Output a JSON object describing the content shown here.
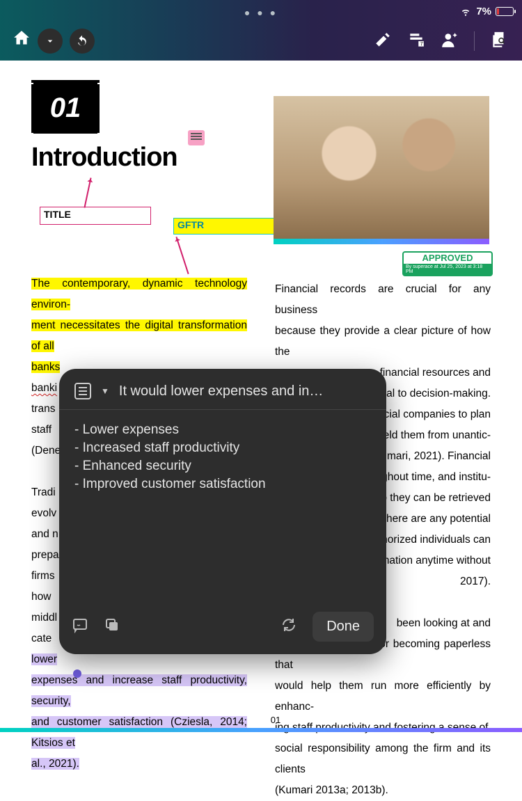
{
  "status": {
    "battery": "7%"
  },
  "chapter": {
    "num": "01",
    "title": "Introduction"
  },
  "annot": {
    "title_box": "TITLE",
    "gftr_box": "GFTR",
    "approved": "APPROVED",
    "approved_sub": "By superace at Jul 25, 2023 at 3:18 PM"
  },
  "col1": {
    "hl1": "The contemporary, dynamic technology environ-",
    "hl2": "ment necessitates the digital transformation of all",
    "hl3": "banks",
    "r1": "banki",
    "r2": "trans",
    "r3": "staff",
    "r4": "(Dene",
    "p2a": "Tradi",
    "p2b": "evolv",
    "p2c": "and n",
    "p2d": "prepa",
    "p2e": "firms",
    "p2f": "how",
    "p2g": "middl",
    "p2h_pre": "cate with them (Cziesla, 2014). ",
    "p2h_hl": "It would lower",
    "p2i": "expenses and increase staff productivity, security,",
    "p2j": "and customer satisfaction (Cziesla, 2014; Kitsios et",
    "p2k": "al., 2021)."
  },
  "col2": {
    "l1": "Financial records are crucial for any business",
    "l2": "because they provide a clear picture of how the",
    "l3r": "financial resources and",
    "l4r": "ntial to decision-making.",
    "l5r": "ancial companies to plan",
    "l6r": "shield them from unantic-",
    "l7r": "(Kumari, 2021). Financial",
    "l8r": "oughout time, and institu-",
    "l9r": "so they can be retrieved",
    "l10r": "if there are any potential",
    "l11r": "thorized individuals can",
    "l12r": "mation anytime without",
    "l13r": " 2017).",
    "l14r": "been looking at and",
    "l15": "developing methods for becoming paperless that",
    "l16": "would help them run more efficiently by enhanc-",
    "l17": "ing staff productivity and fostering a sense of",
    "l18": "social responsibility among the firm and its clients",
    "l19": "(Kumari 2013a; 2013b)."
  },
  "popup": {
    "header": "It would lower expenses and in…",
    "b1": "- Lower expenses",
    "b2": "- Increased staff productivity",
    "b3": "- Enhanced security",
    "b4": "- Improved customer satisfaction",
    "done": "Done"
  },
  "pagenum": "01"
}
